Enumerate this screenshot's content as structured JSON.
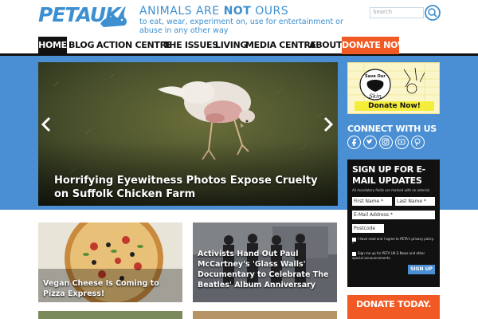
{
  "header": {
    "logo_text": "PETAUK",
    "tagline_pre": "ANIMALS ARE ",
    "tagline_not": "NOT",
    "tagline_post": " OURS",
    "tagline_sub": "to eat, wear, experiment on, use for entertainment or abuse in any other way",
    "search_placeholder": "Search"
  },
  "nav": {
    "items": [
      {
        "label": "Home"
      },
      {
        "label": "Blog"
      },
      {
        "label": "Action Centre"
      },
      {
        "label": "The Issues"
      },
      {
        "label": "Living"
      },
      {
        "label": "Media Centre"
      },
      {
        "label": "About"
      },
      {
        "label": "Donate Now"
      }
    ]
  },
  "hero": {
    "caption": "Horrifying Eyewitness Photos Expose Cruelty on Suffolk Chicken Farm"
  },
  "sidebar": {
    "save_skin_top": "Save Our",
    "save_skin_bottom": "Skin",
    "donate_button": "Donate Now!",
    "connect_title": "Connect With Us",
    "social": [
      "facebook-icon",
      "twitter-icon",
      "instagram-icon",
      "youtube-icon"
    ],
    "signup_title": "Sign Up For E-Mail Updates",
    "signup_note": "All mandatory fields are marked with an asterisk",
    "first_name": "First Name *",
    "last_name": "Last Name *",
    "email": "E-Mail Address *",
    "postcode": "Postcode",
    "consent_1": "I have read and I agree to PETA's privacy policy. *",
    "consent_2": "Sign me up for PETA UK E-News and other special announcements.",
    "signup_button": "SIGN UP",
    "donate_today": "Donate Today."
  },
  "tiles": [
    {
      "caption": "Vegan Cheese Is Coming to Pizza Express!"
    },
    {
      "caption": "Activists Hand Out Paul McCartney's 'Glass Walls' Documentary to Celebrate The Beatles' Album Anniversary"
    }
  ],
  "colors": {
    "brand_blue": "#4a8fd3",
    "donate_orange": "#f15a24",
    "nav_black": "#111111"
  }
}
